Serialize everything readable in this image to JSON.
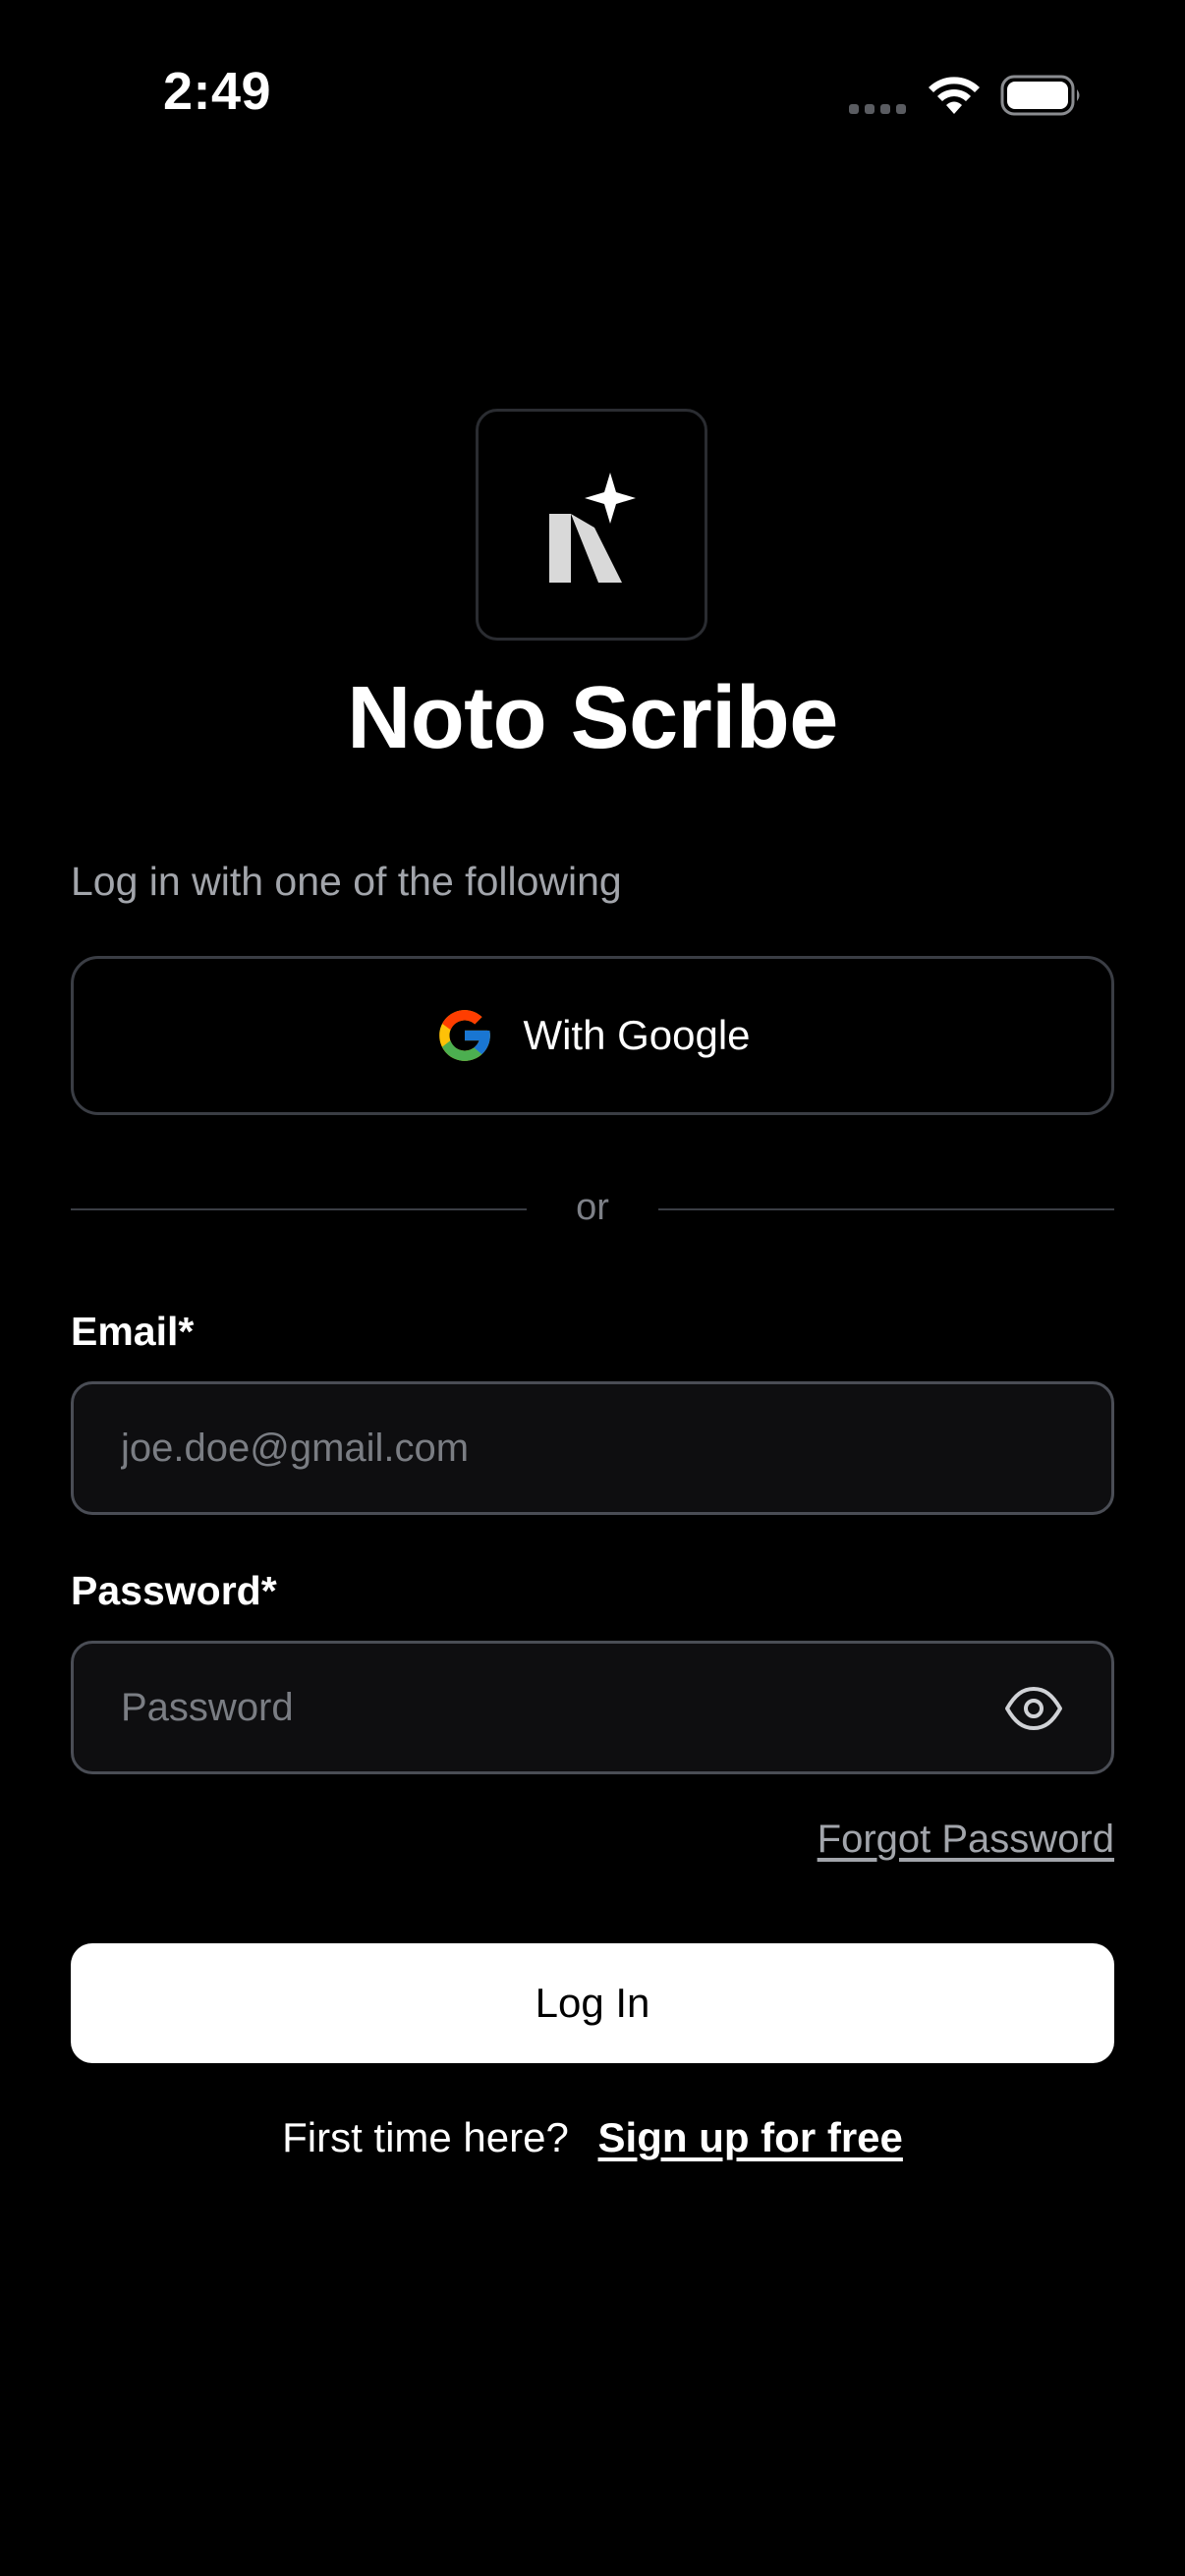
{
  "status_bar": {
    "time": "2:49",
    "signal_icon": "cellular-signal-icon",
    "wifi_icon": "wifi-icon",
    "battery_icon": "battery-icon"
  },
  "app": {
    "title": "Noto Scribe",
    "logo_icon": "noto-scribe-logo-icon"
  },
  "social_login": {
    "subtitle": "Log in with one of the following",
    "google_label": "With Google",
    "google_icon": "google-icon"
  },
  "divider": {
    "text": "or"
  },
  "form": {
    "email_label": "Email*",
    "email_placeholder": "joe.doe@gmail.com",
    "email_value": "",
    "password_label": "Password*",
    "password_placeholder": "Password",
    "password_value": "",
    "password_toggle_icon": "eye-icon",
    "forgot_password": "Forgot Password",
    "login_button": "Log In"
  },
  "signup": {
    "prompt": "First time here?",
    "link": "Sign up for free"
  },
  "colors": {
    "background": "#000000",
    "text_primary": "#ffffff",
    "text_secondary": "#a2a5ab",
    "border": "#3a3d44",
    "button_bg": "#ffffff",
    "button_text": "#000000"
  }
}
